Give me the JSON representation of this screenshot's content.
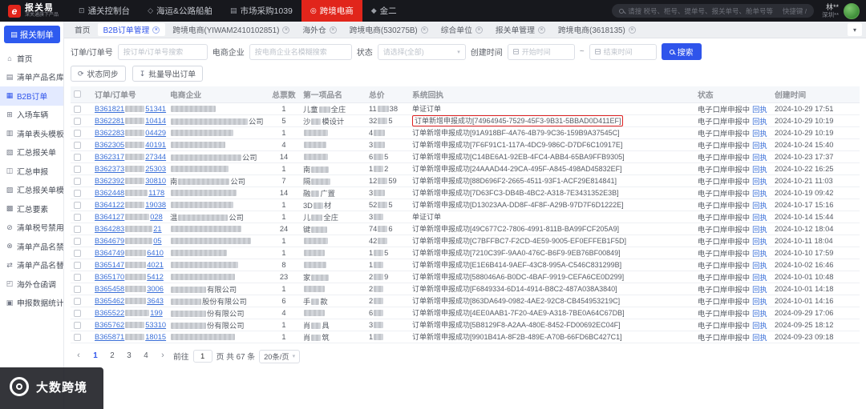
{
  "topbar": {
    "logo": {
      "badge": "e",
      "title": "报关易",
      "subtitle": "深关通旗下产品"
    },
    "menus": [
      {
        "icon": "⊡",
        "label": "通关控制台"
      },
      {
        "icon": "◇",
        "label": "海运&公路船舶"
      },
      {
        "icon": "▤",
        "label": "市场采购1039"
      },
      {
        "icon": "◎",
        "label": "跨境电商",
        "active": true
      },
      {
        "icon": "◆",
        "label": "金二"
      }
    ],
    "search_placeholder": "请搜 税号、柜号、提单号、报关单号、舱单号等",
    "shortcut_hint": "快捷键 /",
    "user": {
      "name": "林**",
      "org": "深圳**"
    }
  },
  "tabbar": {
    "tabs": [
      {
        "label": "首页"
      },
      {
        "label": "B2B订单管理",
        "active": true,
        "closable": true
      },
      {
        "label": "跨境电商(YIWAM2410102851)",
        "closable": true
      },
      {
        "label": "海外仓",
        "closable": true
      },
      {
        "label": "跨境电商(530275B)",
        "closable": true
      },
      {
        "label": "综合单位",
        "closable": true
      },
      {
        "label": "报关单管理",
        "closable": true
      },
      {
        "label": "跨境电商(3618135)",
        "closable": true
      }
    ]
  },
  "sidebar": {
    "cta": "报关制单",
    "cta_icon": "▤",
    "items": [
      {
        "icon": "⌂",
        "label": "首页"
      },
      {
        "icon": "▤",
        "label": "清单产品名库"
      },
      {
        "icon": "▦",
        "label": "B2B订单",
        "active": true
      },
      {
        "icon": "⊞",
        "label": "入场车辆"
      },
      {
        "icon": "▥",
        "label": "清单表头模板"
      },
      {
        "icon": "▧",
        "label": "汇总报关单"
      },
      {
        "icon": "◫",
        "label": "汇总申报"
      },
      {
        "icon": "▨",
        "label": "汇总报关单模板"
      },
      {
        "icon": "▩",
        "label": "汇总要素"
      },
      {
        "icon": "⊘",
        "label": "清单税号禁用"
      },
      {
        "icon": "⊗",
        "label": "清单产品名禁用"
      },
      {
        "icon": "⇄",
        "label": "清单产品名替换"
      },
      {
        "icon": "◰",
        "label": "海外仓函调"
      },
      {
        "icon": "▣",
        "label": "申报数据统计"
      }
    ]
  },
  "filters": {
    "order_label": "订单/订单号",
    "order_placeholder": "按订单/订单号搜索",
    "company_label": "电商企业",
    "company_placeholder": "按电商企业名模糊搜索",
    "status_label": "状态",
    "status_placeholder": "请选择(全部)",
    "time_label": "创建时间",
    "time_start_placeholder": "开始时间",
    "time_separator": "~",
    "time_end_placeholder": "结束时间",
    "search_button": "搜索"
  },
  "actions": {
    "sync": "状态同步",
    "export": "批量导出订单"
  },
  "table": {
    "headers": [
      {
        "label": "订单/订单号"
      },
      {
        "label": "电商企业"
      },
      {
        "label": "总票数"
      },
      {
        "label": "第一项品名"
      },
      {
        "label": "总价"
      },
      {
        "label": "系统回执"
      },
      {
        "label": "状态"
      },
      {
        "label": "创建时间"
      }
    ],
    "receipt_link_label": "回执",
    "rows": [
      {
        "order_pre": "B361821",
        "order_mask": 24,
        "order_suf": "51341",
        "company_pre": "",
        "company_mask": 56,
        "company_suf": "",
        "count": "1",
        "item_pre": "儿童",
        "item_mask": 14,
        "item_suf": "全庄",
        "price_pre": "11",
        "price_mask": 14,
        "price_suf": "38",
        "receipt": "单证订单",
        "receipt_hl": false,
        "status": "电子口岸申报中",
        "created": "2024-10-29 17:51"
      },
      {
        "order_pre": "B362281",
        "order_mask": 24,
        "order_suf": "10414",
        "company_pre": "",
        "company_mask": 96,
        "company_suf": "公司",
        "count": "5",
        "item_pre": "沙",
        "item_mask": 12,
        "item_suf": "模设计",
        "price_pre": "32",
        "price_mask": 12,
        "price_suf": "5",
        "receipt": "订单新增申报成功[74964945-7529-45F3-9B31-5BBAD0D411EF]",
        "receipt_hl": true,
        "status": "电子口岸申报中",
        "created": "2024-10-29 10:19"
      },
      {
        "order_pre": "B362283",
        "order_mask": 24,
        "order_suf": "04429",
        "company_pre": "",
        "company_mask": 78,
        "company_suf": "",
        "count": "1",
        "item_pre": "",
        "item_mask": 30,
        "item_suf": "",
        "price_pre": "4",
        "price_mask": 14,
        "price_suf": "",
        "receipt": "订单新增申报成功[91A918BF-4A76-4B79-9C36-159B9A37545C]",
        "receipt_hl": false,
        "status": "电子口岸申报中",
        "created": "2024-10-29 10:19"
      },
      {
        "order_pre": "B362305",
        "order_mask": 24,
        "order_suf": "40191",
        "company_pre": "",
        "company_mask": 68,
        "company_suf": "",
        "count": "4",
        "item_pre": "",
        "item_mask": 28,
        "item_suf": "",
        "price_pre": "3",
        "price_mask": 14,
        "price_suf": "",
        "receipt": "订单新增申报成功[7F6F91C1-117A-4DC9-986C-D7DF6C10917E]",
        "receipt_hl": false,
        "status": "电子口岸申报中",
        "created": "2024-10-24 15:40"
      },
      {
        "order_pre": "B362317",
        "order_mask": 24,
        "order_suf": "27344",
        "company_pre": "",
        "company_mask": 88,
        "company_suf": "公司",
        "count": "14",
        "item_pre": "",
        "item_mask": 30,
        "item_suf": "",
        "price_pre": "6",
        "price_mask": 12,
        "price_suf": "5",
        "receipt": "订单新增申报成功[C14BE6A1-92EB-4FC4-ABB4-65BA9FFB9305]",
        "receipt_hl": false,
        "status": "电子口岸申报中",
        "created": "2024-10-23 17:37"
      },
      {
        "order_pre": "B362373",
        "order_mask": 24,
        "order_suf": "25303",
        "company_pre": "",
        "company_mask": 72,
        "company_suf": "",
        "count": "1",
        "item_pre": "南",
        "item_mask": 22,
        "item_suf": "",
        "price_pre": "1",
        "price_mask": 12,
        "price_suf": "2",
        "receipt": "订单新增申报成功[24AAAD44-29CA-495F-A845-498AD45832EF]",
        "receipt_hl": false,
        "status": "电子口岸申报中",
        "created": "2024-10-22 16:25"
      },
      {
        "order_pre": "B362392",
        "order_mask": 24,
        "order_suf": "30810",
        "company_pre": "南",
        "company_mask": 64,
        "company_suf": "公司",
        "count": "7",
        "item_pre": "隔",
        "item_mask": 24,
        "item_suf": "",
        "price_pre": "12",
        "price_mask": 12,
        "price_suf": "59",
        "receipt": "订单新增申报成功[88D696F2-2665-4511-93F1-ACF29E814841]",
        "receipt_hl": false,
        "status": "电子口岸申报中",
        "created": "2024-10-21 11:03"
      },
      {
        "order_pre": "B362448",
        "order_mask": 28,
        "order_suf": "1178",
        "company_pre": "",
        "company_mask": 82,
        "company_suf": "",
        "count": "14",
        "item_pre": "融",
        "item_mask": 10,
        "item_suf": "广置",
        "price_pre": "3",
        "price_mask": 14,
        "price_suf": "",
        "receipt": "订单新增申报成功[7D63FC3-DB4B-4BC2-A318-7E3431352E3B]",
        "receipt_hl": false,
        "status": "电子口岸申报中",
        "created": "2024-10-19 09:42"
      },
      {
        "order_pre": "B364122",
        "order_mask": 24,
        "order_suf": "19038",
        "company_pre": "",
        "company_mask": 78,
        "company_suf": "",
        "count": "1",
        "item_pre": "3D",
        "item_mask": 12,
        "item_suf": "材",
        "price_pre": "52",
        "price_mask": 12,
        "price_suf": "5",
        "receipt": "订单新增申报成功[D13023AA-DD8F-4F8F-A29B-97D7F6D1222E]",
        "receipt_hl": false,
        "status": "电子口岸申报中",
        "created": "2024-10-17 15:16"
      },
      {
        "order_pre": "B364127",
        "order_mask": 30,
        "order_suf": "028",
        "company_pre": "温",
        "company_mask": 62,
        "company_suf": "公司",
        "count": "1",
        "item_pre": "儿",
        "item_mask": 14,
        "item_suf": "全庄",
        "price_pre": "3",
        "price_mask": 12,
        "price_suf": "",
        "receipt": "单证订单",
        "receipt_hl": false,
        "status": "电子口岸申报中",
        "created": "2024-10-14 15:44"
      },
      {
        "order_pre": "B364283",
        "order_mask": 34,
        "order_suf": "21",
        "company_pre": "",
        "company_mask": 88,
        "company_suf": "",
        "count": "24",
        "item_pre": "键",
        "item_mask": 20,
        "item_suf": "",
        "price_pre": "74",
        "price_mask": 12,
        "price_suf": "6",
        "receipt": "订单新增申报成功[49C677C2-7806-4991-811B-BA99FCF205A9]",
        "receipt_hl": false,
        "status": "电子口岸申报中",
        "created": "2024-10-12 18:04"
      },
      {
        "order_pre": "B364679",
        "order_mask": 34,
        "order_suf": "05",
        "company_pre": "",
        "company_mask": 100,
        "company_suf": "",
        "count": "1",
        "item_pre": "",
        "item_mask": 30,
        "item_suf": "",
        "price_pre": "42",
        "price_mask": 12,
        "price_suf": "",
        "receipt": "订单新增申报成功[C7BFFBC7-F2CD-4E59-9005-EF0EFFEB1F5D]",
        "receipt_hl": false,
        "status": "电子口岸申报中",
        "created": "2024-10-11 18:04"
      },
      {
        "order_pre": "B364749",
        "order_mask": 26,
        "order_suf": "6410",
        "company_pre": "",
        "company_mask": 70,
        "company_suf": "",
        "count": "1",
        "item_pre": "",
        "item_mask": 26,
        "item_suf": "",
        "price_pre": "1",
        "price_mask": 12,
        "price_suf": "5",
        "receipt": "订单新增申报成功[7210C39F-9AA0-476C-B6F9-9EB76BF00849]",
        "receipt_hl": false,
        "status": "电子口岸申报中",
        "created": "2024-10-10 17:59"
      },
      {
        "order_pre": "B365147",
        "order_mask": 26,
        "order_suf": "4021",
        "company_pre": "",
        "company_mask": 84,
        "company_suf": "",
        "count": "8",
        "item_pre": "",
        "item_mask": 28,
        "item_suf": "",
        "price_pre": "1",
        "price_mask": 12,
        "price_suf": "",
        "receipt": "订单新增申报成功[E1E6B414-9AEF-43C8-995A-C546C831299B]",
        "receipt_hl": false,
        "status": "电子口岸申报中",
        "created": "2024-10-02 16:46"
      },
      {
        "order_pre": "B365170",
        "order_mask": 26,
        "order_suf": "5412",
        "company_pre": "",
        "company_mask": 80,
        "company_suf": "",
        "count": "23",
        "item_pre": "家",
        "item_mask": 22,
        "item_suf": "",
        "price_pre": "2",
        "price_mask": 12,
        "price_suf": "9",
        "receipt": "订单新增申报成功[588046A6-B0DC-4BAF-9919-CEFA6CE0D299]",
        "receipt_hl": false,
        "status": "电子口岸申报中",
        "created": "2024-10-01 10:48"
      },
      {
        "order_pre": "B365458",
        "order_mask": 26,
        "order_suf": "3006",
        "company_pre": "",
        "company_mask": 44,
        "company_suf": "有限公司",
        "count": "1",
        "item_pre": "",
        "item_mask": 26,
        "item_suf": "",
        "price_pre": "2",
        "price_mask": 12,
        "price_suf": "",
        "receipt": "订单新增申报成功[F6849334-6D14-4914-B8C2-487A038A3840]",
        "receipt_hl": false,
        "status": "电子口岸申报中",
        "created": "2024-10-01 14:18"
      },
      {
        "order_pre": "B365462",
        "order_mask": 26,
        "order_suf": "3643",
        "company_pre": "",
        "company_mask": 38,
        "company_suf": "股份有限公司",
        "count": "6",
        "item_pre": "手",
        "item_mask": 10,
        "item_suf": "款",
        "price_pre": "2",
        "price_mask": 12,
        "price_suf": "",
        "receipt": "订单新增申报成功[863DA649-0982-4AE2-92C8-CB454953219C]",
        "receipt_hl": false,
        "status": "电子口岸申报中",
        "created": "2024-10-01 14:16"
      },
      {
        "order_pre": "B365522",
        "order_mask": 30,
        "order_suf": "199",
        "company_pre": "",
        "company_mask": 44,
        "company_suf": "份有限公司",
        "count": "4",
        "item_pre": "",
        "item_mask": 26,
        "item_suf": "",
        "price_pre": "6",
        "price_mask": 12,
        "price_suf": "",
        "receipt": "订单新增申报成功[4EE0AAB1-7F20-4AE9-A318-7BE0A64C67DB]",
        "receipt_hl": false,
        "status": "电子口岸申报中",
        "created": "2024-09-29 17:06"
      },
      {
        "order_pre": "B365762",
        "order_mask": 24,
        "order_suf": "53310",
        "company_pre": "",
        "company_mask": 44,
        "company_suf": "份有限公司",
        "count": "1",
        "item_pre": "肖",
        "item_mask": 12,
        "item_suf": "具",
        "price_pre": "3",
        "price_mask": 12,
        "price_suf": "",
        "receipt": "订单新增申报成功[5B8129F8-A2AA-480E-8452-FD00692EC04F]",
        "receipt_hl": false,
        "status": "电子口岸申报中",
        "created": "2024-09-25 18:12"
      },
      {
        "order_pre": "B365871",
        "order_mask": 24,
        "order_suf": "18015",
        "company_pre": "",
        "company_mask": 80,
        "company_suf": "",
        "count": "1",
        "item_pre": "肖",
        "item_mask": 12,
        "item_suf": "筑",
        "price_pre": "1",
        "price_mask": 12,
        "price_suf": "",
        "receipt": "订单新增申报成功[9901B41A-8F2B-489E-A70B-66FD6BC427C1]",
        "receipt_hl": false,
        "status": "电子口岸申报中",
        "created": "2024-09-23 09:18"
      }
    ]
  },
  "pagination": {
    "pages": [
      {
        "label": "1",
        "active": true
      },
      {
        "label": "2"
      },
      {
        "label": "3"
      },
      {
        "label": "4"
      }
    ],
    "goto_label": "前往",
    "current": "1",
    "total_label": "页 共 67 条",
    "page_size": "20条/页"
  },
  "watermark": {
    "text": "大数跨境"
  },
  "colors": {
    "accent": "#2f54eb",
    "brand_red": "#e1251b",
    "highlight_box": "#e02020",
    "link": "#3a6fd8"
  }
}
